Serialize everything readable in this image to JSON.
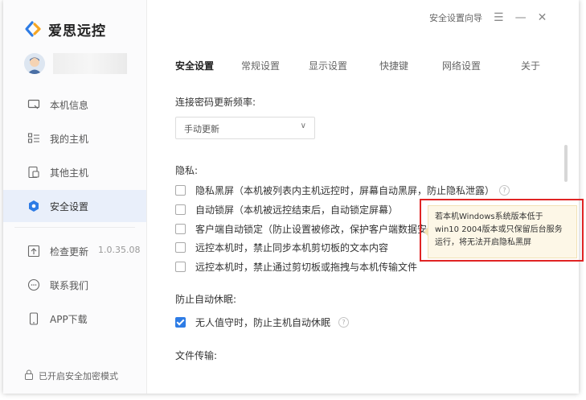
{
  "app": {
    "name": "爱思远控"
  },
  "window_controls": {
    "guide": "安全设置向导",
    "menu": "☰",
    "minimize": "—",
    "close": "✕"
  },
  "sidebar": {
    "items": [
      {
        "label": "本机信息",
        "icon": "monitor-icon"
      },
      {
        "label": "我的主机",
        "icon": "list-icon"
      },
      {
        "label": "其他主机",
        "icon": "devices-icon"
      },
      {
        "label": "安全设置",
        "icon": "shield-icon",
        "active": true
      },
      {
        "label": "检查更新",
        "icon": "upload-icon",
        "version": "1.0.35.08"
      },
      {
        "label": "联系我们",
        "icon": "chat-icon"
      },
      {
        "label": "APP下载",
        "icon": "phone-icon"
      }
    ],
    "footer": "已开启安全加密模式"
  },
  "tabs": [
    "安全设置",
    "常规设置",
    "显示设置",
    "快捷键",
    "网络设置",
    "关于"
  ],
  "sections": {
    "password_label": "连接密码更新频率:",
    "password_select": "手动更新",
    "privacy_label": "隐私:",
    "privacy_options": [
      {
        "text": "隐私黑屏（本机被列表内主机远控时，屏幕自动黑屏，防止隐私泄露）",
        "checked": false,
        "help": true
      },
      {
        "text": "自动锁屏（本机被远控结束后，自动锁定屏幕）",
        "checked": false
      },
      {
        "text": "客户端自动锁定（防止设置被修改，保护客户端数据安全）",
        "checked": false
      },
      {
        "text": "远控本机时，禁止同步本机剪切板的文本内容",
        "checked": false
      },
      {
        "text": "远控本机时，禁止通过剪切板或拖拽与本机传输文件",
        "checked": false
      }
    ],
    "sleep_label": "防止自动休眠:",
    "sleep_option": {
      "text": "无人值守时，防止主机自动休眠",
      "checked": true,
      "help": true
    },
    "file_label": "文件传输:"
  },
  "tooltip": {
    "lines": [
      "若本机Windows系统版本低于",
      "win10 2004版本或只保留后台服务",
      "运行，将无法开启隐私黑屏"
    ]
  },
  "colors": {
    "accent": "#2e7ce5",
    "active_bg": "#e9effa",
    "highlight": "#e02424",
    "tooltip_bg": "#fdf7e7"
  }
}
